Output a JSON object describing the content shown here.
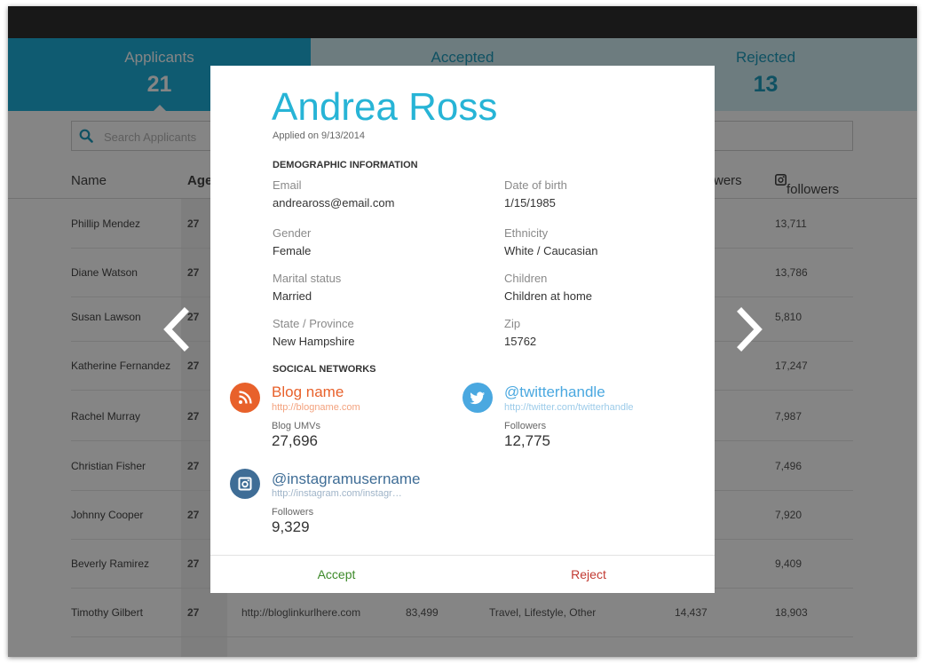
{
  "tabs": [
    {
      "label": "Applicants",
      "count": "21"
    },
    {
      "label": "Accepted",
      "count": ""
    },
    {
      "label": "Rejected",
      "count": "13"
    }
  ],
  "search": {
    "placeholder": "Search Applicants"
  },
  "table": {
    "headers": {
      "name": "Name",
      "age": "Age",
      "twitter_followers": "wers",
      "instagram_followers": "followers"
    },
    "rows": [
      {
        "name": "Phillip Mendez",
        "age": "27",
        "ig_followers": "13,711",
        "blog_url": "",
        "umvs": "",
        "categories": "",
        "tw_followers": ""
      },
      {
        "name": "Diane Watson",
        "age": "27",
        "ig_followers": "13,786",
        "blog_url": "",
        "umvs": "",
        "categories": "",
        "tw_followers": ""
      },
      {
        "name": "Susan Lawson",
        "age": "27",
        "ig_followers": "5,810",
        "blog_url": "",
        "umvs": "",
        "categories": "",
        "tw_followers": ""
      },
      {
        "name": "Katherine Fernandez",
        "age": "27",
        "ig_followers": "17,247",
        "blog_url": "",
        "umvs": "",
        "categories": "",
        "tw_followers": ""
      },
      {
        "name": "Rachel Murray",
        "age": "27",
        "ig_followers": "7,987",
        "blog_url": "",
        "umvs": "",
        "categories": "",
        "tw_followers": ""
      },
      {
        "name": "Christian Fisher",
        "age": "27",
        "ig_followers": "7,496",
        "blog_url": "",
        "umvs": "",
        "categories": "",
        "tw_followers": ""
      },
      {
        "name": "Johnny Cooper",
        "age": "27",
        "ig_followers": "7,920",
        "blog_url": "",
        "umvs": "",
        "categories": "",
        "tw_followers": ""
      },
      {
        "name": "Beverly Ramirez",
        "age": "27",
        "ig_followers": "9,409",
        "blog_url": "",
        "umvs": "",
        "categories": "",
        "tw_followers": ""
      },
      {
        "name": "Timothy Gilbert",
        "age": "27",
        "ig_followers": "18,903",
        "blog_url": "http://bloglinkurlhere.com",
        "umvs": "83,499",
        "categories": "Travel, Lifestyle, Other",
        "tw_followers": "14,437"
      }
    ]
  },
  "modal": {
    "name": "Andrea Ross",
    "applied": "Applied on 9/13/2014",
    "demographic_title": "DEMOGRAPHIC INFORMATION",
    "fields": {
      "email": {
        "label": "Email",
        "value": "andreaross@email.com"
      },
      "dob": {
        "label": "Date of birth",
        "value": "1/15/1985"
      },
      "gender": {
        "label": "Gender",
        "value": "Female"
      },
      "ethnicity": {
        "label": "Ethnicity",
        "value": "White / Caucasian"
      },
      "marital": {
        "label": "Marital status",
        "value": "Married"
      },
      "children": {
        "label": "Children",
        "value": "Children at home"
      },
      "state": {
        "label": "State / Province",
        "value": "New Hampshire"
      },
      "zip": {
        "label": "Zip",
        "value": "15762"
      }
    },
    "social_title": "SOCICAL NETWORKS",
    "blog": {
      "name": "Blog name",
      "url": "http://blogname.com",
      "stat_label": "Blog UMVs",
      "stat_value": "27,696"
    },
    "twitter": {
      "name": "@twitterhandle",
      "url": "http://twitter.com/twitterhandle",
      "stat_label": "Followers",
      "stat_value": "12,775"
    },
    "instagram": {
      "name": "@instagramusername",
      "url": "http://instagram.com/instagr…",
      "stat_label": "Followers",
      "stat_value": "9,329"
    },
    "accept_label": "Accept",
    "reject_label": "Reject"
  },
  "icons": [
    "search-icon",
    "instagram-icon",
    "chevron-left-icon",
    "chevron-right-icon",
    "rss-icon",
    "twitter-bird-icon",
    "camera-icon"
  ],
  "colors": {
    "active_tab": "#1eaed8",
    "inactive_tab": "#d2edf4",
    "accent": "#27b4d6",
    "blog": "#e8612b",
    "twitter": "#4aa8e0",
    "instagram": "#3f6d96",
    "accept": "#3d8a2a",
    "reject": "#c23a32"
  }
}
